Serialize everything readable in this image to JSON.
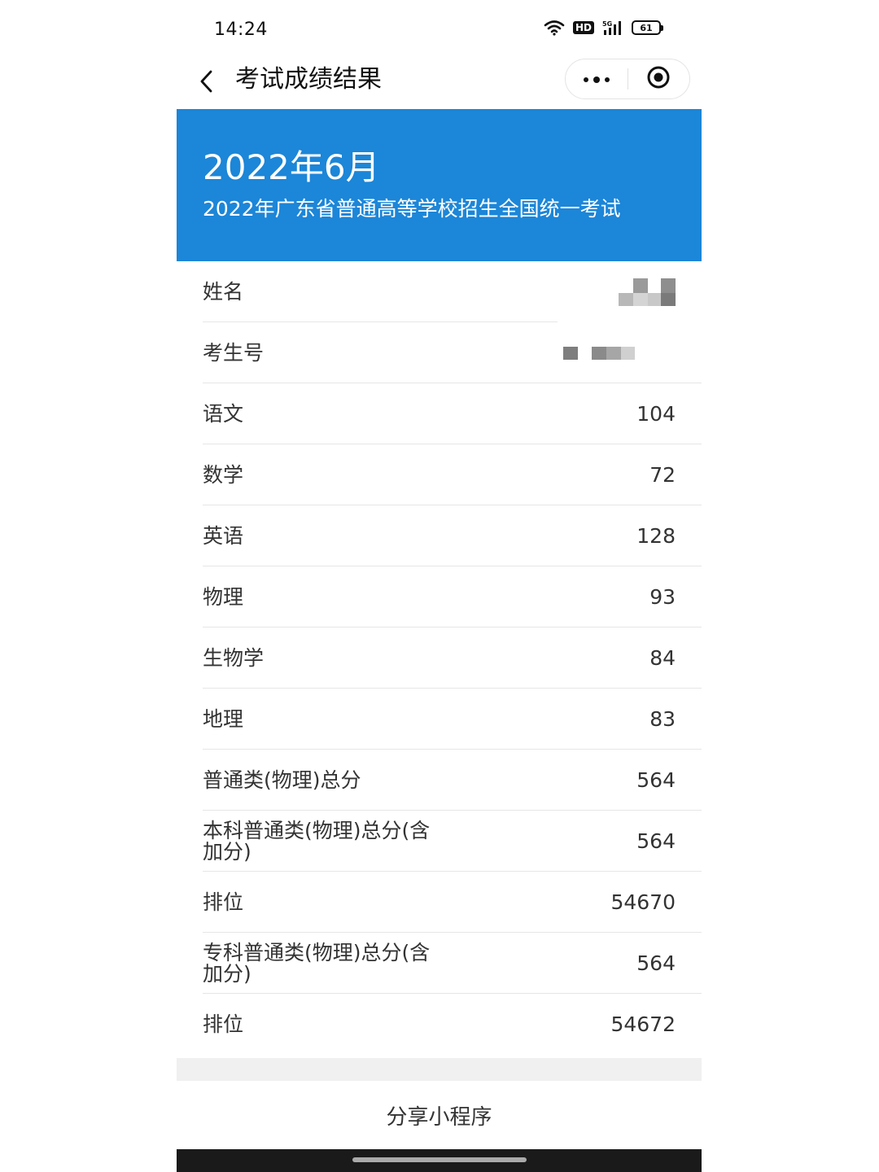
{
  "status_bar": {
    "time": "14:24",
    "network": "5G",
    "hd": "HD",
    "battery": "61"
  },
  "nav": {
    "title": "考试成绩结果",
    "back_icon": "chevron-left-icon",
    "more_icon": "more-dots-icon",
    "close_icon": "target-close-icon"
  },
  "banner": {
    "title": "2022年6月",
    "subtitle": "2022年广东省普通高等学校招生全国统一考试",
    "background": "#1c86d8"
  },
  "rows": [
    {
      "label": "姓名",
      "value": ""
    },
    {
      "label": "考生号",
      "value": ""
    },
    {
      "label": "语文",
      "value": "104"
    },
    {
      "label": "数学",
      "value": "72"
    },
    {
      "label": "英语",
      "value": "128"
    },
    {
      "label": "物理",
      "value": "93"
    },
    {
      "label": "生物学",
      "value": "84"
    },
    {
      "label": "地理",
      "value": "83"
    },
    {
      "label": "普通类(物理)总分",
      "value": "564"
    },
    {
      "label": "本科普通类(物理)总分(含加分)",
      "value": "564"
    },
    {
      "label": "排位",
      "value": "54670"
    },
    {
      "label": "专科普通类(物理)总分(含加分)",
      "value": "564"
    },
    {
      "label": "排位",
      "value": "54672"
    }
  ],
  "share_label": "分享小程序"
}
